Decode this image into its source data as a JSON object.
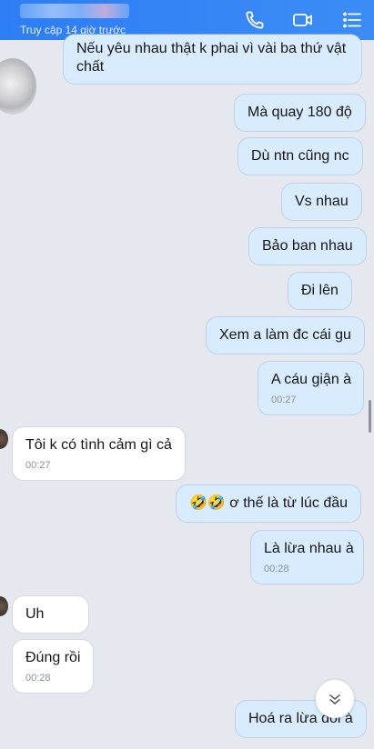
{
  "header": {
    "status": "Truy cập 14 giờ trước",
    "icons": [
      "phone-icon",
      "video-icon",
      "menu-icon"
    ]
  },
  "messages": [
    {
      "side": "mine",
      "text": "Nếu yêu nhau thật k phai vì vài ba thứ vật chất",
      "time": ""
    },
    {
      "side": "mine",
      "text": "Mà quay 180 độ",
      "time": ""
    },
    {
      "side": "mine",
      "text": "Dù ntn cũng nc",
      "time": ""
    },
    {
      "side": "mine",
      "text": "Vs nhau",
      "time": ""
    },
    {
      "side": "mine",
      "text": "Bảo ban nhau",
      "time": ""
    },
    {
      "side": "mine",
      "text": "Đi lên",
      "time": ""
    },
    {
      "side": "mine",
      "text": "Xem a làm đc cái gu",
      "time": ""
    },
    {
      "side": "mine",
      "text": "A cáu giận à",
      "time": "00:27"
    },
    {
      "side": "theirs",
      "text": "Tôi k có tình cảm gì cả",
      "time": "00:27"
    },
    {
      "side": "mine",
      "text": "🤣🤣 ơ thế là từ lúc đầu",
      "time": ""
    },
    {
      "side": "mine",
      "text": "Là lừa nhau à",
      "time": "00:28"
    },
    {
      "side": "theirs",
      "text": "Uh",
      "time": ""
    },
    {
      "side": "theirs",
      "text": "Đúng rồi",
      "time": "00:28"
    },
    {
      "side": "mine",
      "text": "Hoá ra lừa đối à",
      "time": ""
    }
  ]
}
